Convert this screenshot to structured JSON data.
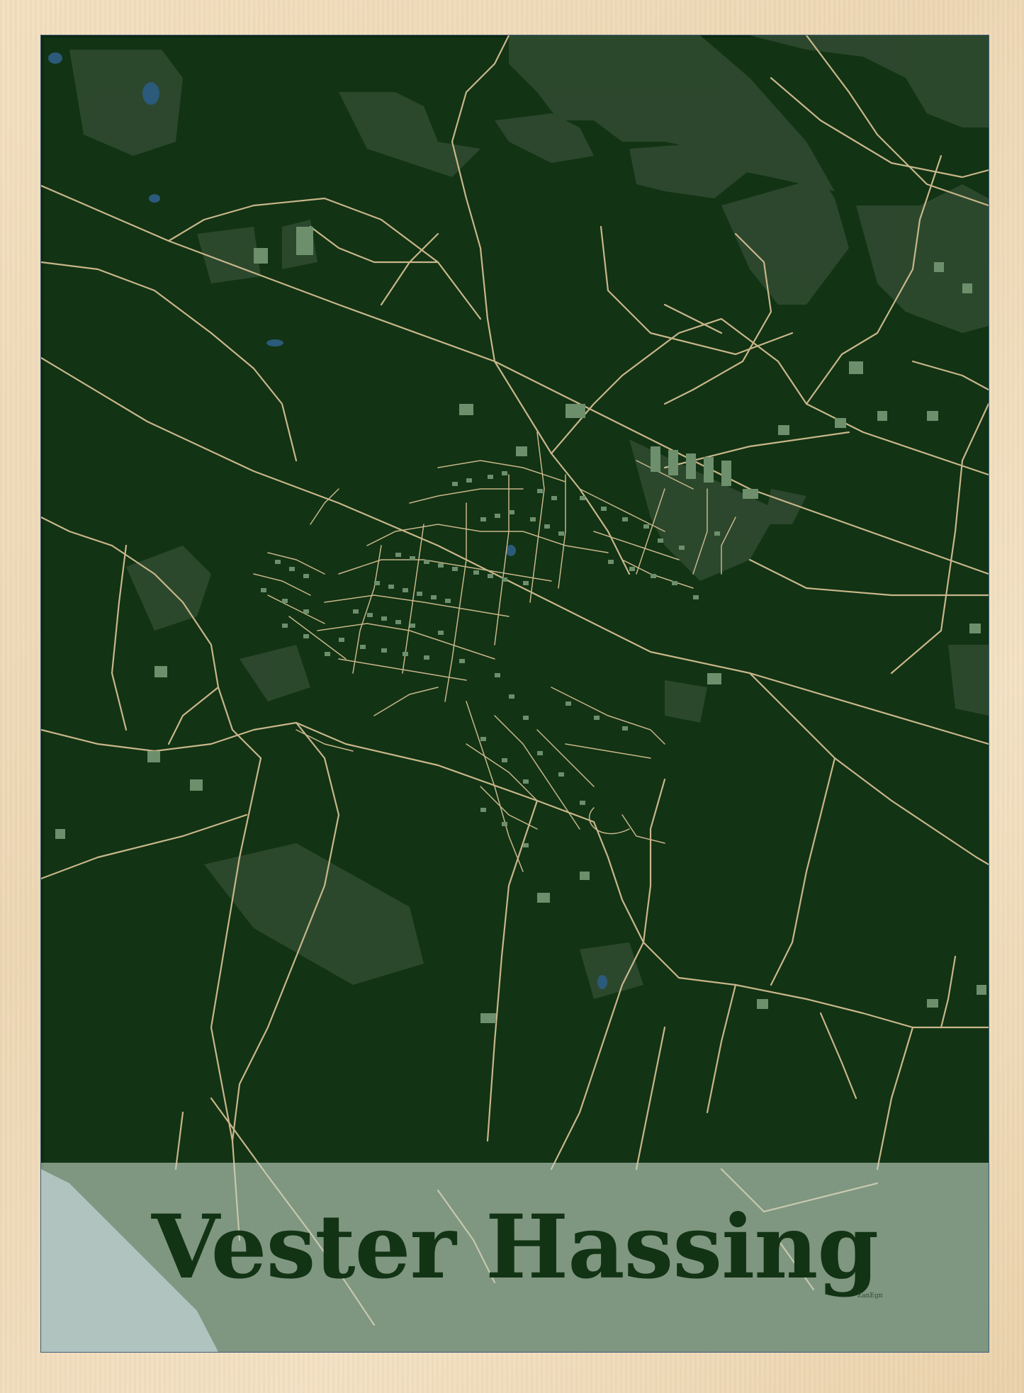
{
  "poster": {
    "title": "Vester Hassing",
    "signature": "ZanEgn"
  },
  "colors": {
    "background": "#123314",
    "roads": "#c8b68a",
    "buildings": "#6e8f6c",
    "areas": "#2f4a30",
    "water": "#2b5a7a",
    "band": "#c4d4c4",
    "sea": "#93a9b9",
    "frame": "#efdcbd"
  }
}
